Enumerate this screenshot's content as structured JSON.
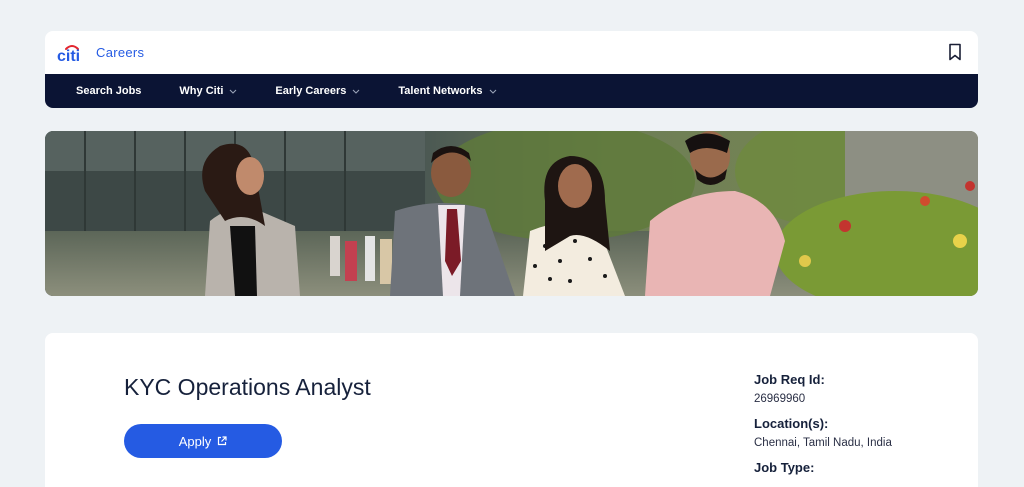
{
  "header": {
    "logo_text": "citi",
    "careers_label": "Careers",
    "bookmark_icon": "bookmark-icon"
  },
  "nav": {
    "items": [
      {
        "label": "Search Jobs",
        "has_dropdown": false
      },
      {
        "label": "Why Citi",
        "has_dropdown": true
      },
      {
        "label": "Early Careers",
        "has_dropdown": true
      },
      {
        "label": "Talent Networks",
        "has_dropdown": true
      }
    ]
  },
  "job": {
    "title": "KYC Operations Analyst",
    "apply_label": "Apply",
    "req_id_label": "Job Req Id:",
    "req_id_value": "26969960",
    "location_label": "Location(s):",
    "location_value": "Chennai, Tamil Nadu, India",
    "job_type_label": "Job Type:"
  },
  "colors": {
    "brand_blue": "#255be3",
    "nav_bg": "#0b1434",
    "page_bg": "#eef2f5"
  }
}
